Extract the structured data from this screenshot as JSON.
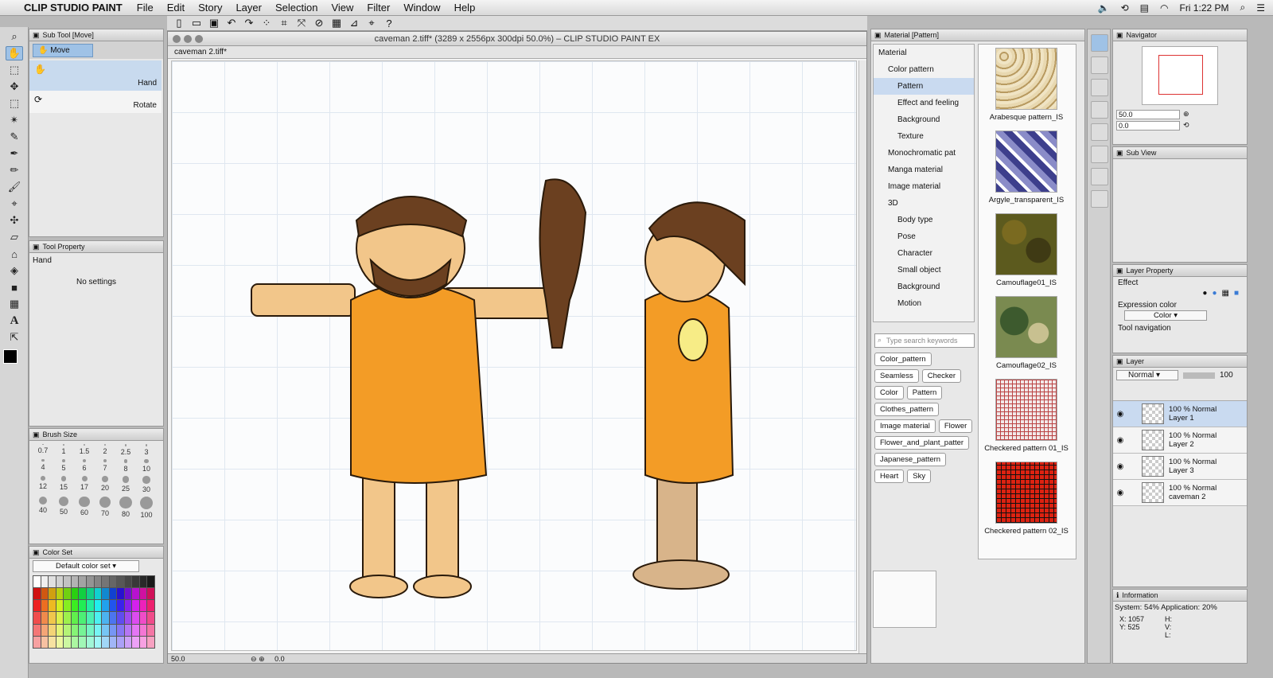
{
  "menubar": {
    "app": "CLIP STUDIO PAINT",
    "items": [
      "File",
      "Edit",
      "Story",
      "Layer",
      "Selection",
      "View",
      "Filter",
      "Window",
      "Help"
    ],
    "clock": "Fri 1:22 PM"
  },
  "window": {
    "title": "caveman 2.tiff* (3289 x 2556px 300dpi 50.0%)  – CLIP STUDIO PAINT EX",
    "tab": "caveman 2.tiff*",
    "zoom": "50.0",
    "angle": "0.0"
  },
  "subtool": {
    "header": "Sub Tool [Move]",
    "group": "Move",
    "items": [
      "Hand",
      "Rotate"
    ]
  },
  "toolprop": {
    "header": "Tool Property",
    "name": "Hand",
    "empty": "No settings"
  },
  "brushsize": {
    "header": "Brush Size",
    "sizes": [
      "0.7",
      "1",
      "1.5",
      "2",
      "2.5",
      "3",
      "4",
      "5",
      "6",
      "7",
      "8",
      "10",
      "12",
      "15",
      "17",
      "20",
      "25",
      "30",
      "40",
      "50",
      "60",
      "70",
      "80",
      "100"
    ]
  },
  "colorset": {
    "header": "Color Set",
    "selected": "Default color set"
  },
  "material": {
    "header": "Material [Pattern]",
    "tree": [
      "Material",
      "Color pattern",
      "Pattern",
      "Effect and feeling",
      "Background",
      "Texture",
      "Monochromatic pat",
      "Manga material",
      "Image material",
      "3D",
      "Body type",
      "Pose",
      "Character",
      "Small object",
      "Background",
      "Motion"
    ],
    "search_placeholder": "Type search keywords",
    "tags": [
      "Color_pattern",
      "Seamless",
      "Checker",
      "Color",
      "Pattern",
      "Clothes_pattern",
      "Image material",
      "Flower",
      "Flower_and_plant_patter",
      "Japanese_pattern",
      "Heart",
      "Sky"
    ],
    "items": [
      "Arabesque pattern_IS",
      "Argyle_transparent_IS",
      "Camouflage01_IS",
      "Camouflage02_IS",
      "Checkered pattern 01_IS",
      "Checkered pattern 02_IS"
    ]
  },
  "navigator": {
    "header": "Navigator",
    "zoom": "50.0",
    "angle": "0.0"
  },
  "subview": {
    "header": "Sub View"
  },
  "layerprop": {
    "header": "Layer Property",
    "effect": "Effect",
    "expression": "Expression color",
    "color": "Color",
    "toolnav": "Tool navigation"
  },
  "layer": {
    "header": "Layer",
    "blend": "Normal",
    "opacity": "100",
    "rows": [
      {
        "mode": "100 % Normal",
        "name": "Layer 1"
      },
      {
        "mode": "100 % Normal",
        "name": "Layer 2"
      },
      {
        "mode": "100 % Normal",
        "name": "Layer 3"
      },
      {
        "mode": "100 % Normal",
        "name": "caveman 2"
      }
    ]
  },
  "info": {
    "header": "Information",
    "system": "System: 54% Application: 20%",
    "x": "X: 1057",
    "y": "Y: 525",
    "h": "H:",
    "v": "V:",
    "l": "L:"
  }
}
